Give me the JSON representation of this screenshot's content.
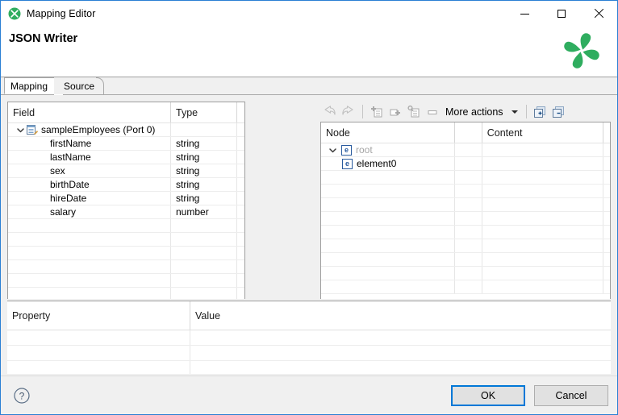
{
  "window": {
    "title": "Mapping Editor",
    "icon": "clover-icon",
    "controls": {
      "minimize": "minimize-button",
      "maximize": "maximize-button",
      "close": "close-button"
    }
  },
  "header": {
    "title": "JSON Writer",
    "logo": "clover-logo"
  },
  "tabs": [
    {
      "label": "Mapping",
      "active": true
    },
    {
      "label": "Source",
      "active": false
    }
  ],
  "field_table": {
    "columns": [
      "Field",
      "Type"
    ],
    "rows": [
      {
        "indent": 0,
        "icon": "record-icon",
        "twisty": "chevron-down-icon",
        "field": "sampleEmployees (Port 0)",
        "type": ""
      },
      {
        "indent": 1,
        "icon": "",
        "twisty": "",
        "field": "firstName",
        "type": "string"
      },
      {
        "indent": 1,
        "icon": "",
        "twisty": "",
        "field": "lastName",
        "type": "string"
      },
      {
        "indent": 1,
        "icon": "",
        "twisty": "",
        "field": "sex",
        "type": "string"
      },
      {
        "indent": 1,
        "icon": "",
        "twisty": "",
        "field": "birthDate",
        "type": "string"
      },
      {
        "indent": 1,
        "icon": "",
        "twisty": "",
        "field": "hireDate",
        "type": "string"
      },
      {
        "indent": 1,
        "icon": "",
        "twisty": "",
        "field": "salary",
        "type": "number"
      }
    ],
    "empty_rows": 6
  },
  "toolbar": {
    "undo": "undo-icon",
    "redo": "redo-icon",
    "add_element": "add-element-icon",
    "add_sibling": "add-sibling-icon",
    "add_attribute": "add-attribute-icon",
    "add_text": "add-text-icon",
    "more_actions_label": "More actions",
    "more_actions_caret": "chevron-down-icon",
    "expand_all": "expand-all-icon",
    "collapse_all": "collapse-all-icon"
  },
  "node_table": {
    "columns": [
      "Node",
      "",
      "Content"
    ],
    "rows": [
      {
        "indent": 0,
        "twisty": "chevron-down-icon",
        "icon": "e",
        "node": "root",
        "muted": true,
        "content": ""
      },
      {
        "indent": 1,
        "twisty": "",
        "icon": "e",
        "node": "element0",
        "muted": false,
        "content": ""
      }
    ],
    "empty_rows": 9
  },
  "property_table": {
    "columns": [
      "Property",
      "Value"
    ],
    "rows": [],
    "empty_rows": 3
  },
  "buttons": {
    "help": "help-icon",
    "ok": "OK",
    "cancel": "Cancel"
  },
  "colors": {
    "brand_green": "#2fad5f",
    "focus_blue": "#0078d7",
    "window_border": "#2a7fd4",
    "icon_blue": "#2a5b9e"
  }
}
